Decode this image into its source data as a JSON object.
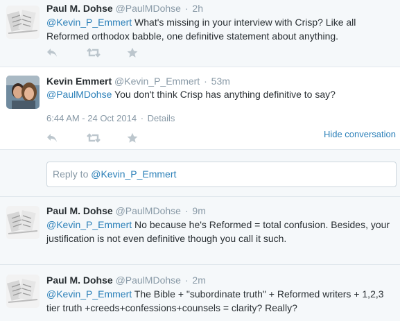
{
  "tweets": [
    {
      "fullname": "Paul M. Dohse",
      "screen_name": "@PaulMDohse",
      "time": "2h",
      "mention": "@Kevin_P_Emmert",
      "text": " What's missing in your interview with Crisp? Like all Reformed orthodox babble, one definitive statement about anything.",
      "icons": [
        "reply-icon",
        "retweet-icon",
        "favorite-icon"
      ]
    },
    {
      "fullname": "Kevin Emmert",
      "screen_name": "@Kevin_P_Emmert",
      "time": "53m",
      "mention": "@PaulMDohse",
      "text": " You don't think Crisp has anything definitive to say?",
      "timestamp": "6:44 AM - 24 Oct 2014",
      "details_label": "Details",
      "hide_label": "Hide conversation",
      "icons": [
        "reply-icon",
        "retweet-icon",
        "favorite-icon"
      ]
    },
    {
      "fullname": "Paul M. Dohse",
      "screen_name": "@PaulMDohse",
      "time": "9m",
      "mention": "@Kevin_P_Emmert",
      "text": " No because he's Reformed = total confusion.  Besides, your justification is not even definitive though you call it such."
    },
    {
      "fullname": "Paul M. Dohse",
      "screen_name": "@PaulMDohse",
      "time": "2m",
      "mention": "@Kevin_P_Emmert",
      "text": " The Bible + \"subordinate truth\" + Reformed writers + 1,2,3 tier truth +creeds+confessions+counsels = clarity? Really?"
    }
  ],
  "reply": {
    "prefix": "Reply to ",
    "mention": "@Kevin_P_Emmert"
  },
  "separator": "·",
  "colors": {
    "link": "#2a7fb8",
    "muted": "#8899a6",
    "icon": "#bcc6cd"
  }
}
